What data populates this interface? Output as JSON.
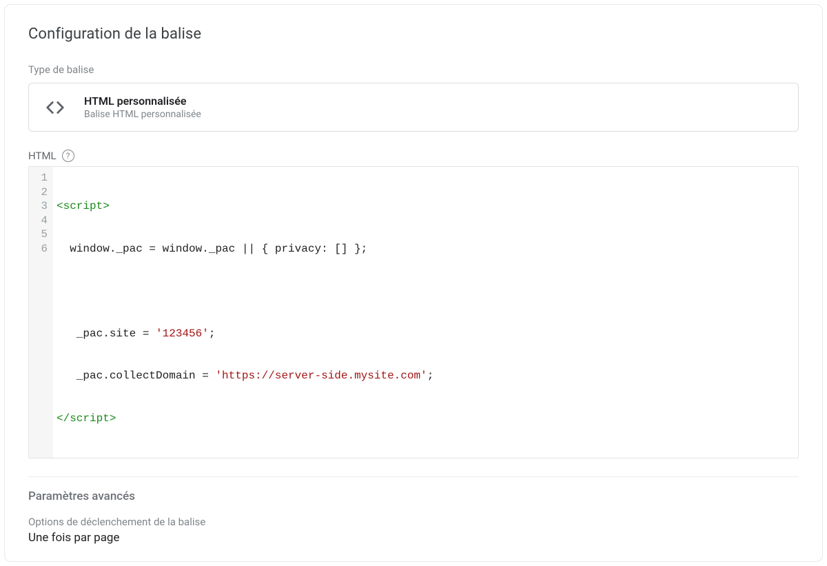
{
  "header": {
    "title": "Configuration de la balise"
  },
  "tagType": {
    "label": "Type de balise",
    "name": "HTML personnalisée",
    "description": "Balise HTML personnalisée",
    "iconName": "code-icon"
  },
  "htmlField": {
    "label": "HTML",
    "lineNumbers": [
      "1",
      "2",
      "3",
      "4",
      "5",
      "6"
    ],
    "code": {
      "line1_tag": "<script>",
      "line2_plain": "  window._pac = window._pac || { privacy: [] };",
      "line3_plain": "",
      "line4_prefix": "   _pac.site = ",
      "line4_str": "'123456'",
      "line4_suffix": ";",
      "line5_prefix": "   _pac.collectDomain = ",
      "line5_str": "'https://server-side.mysite.com'",
      "line5_suffix": ";",
      "line6_tag": "</script>"
    }
  },
  "advanced": {
    "title": "Paramètres avancés",
    "triggerOptionLabel": "Options de déclenchement de la balise",
    "triggerOptionValue": "Une fois par page"
  }
}
